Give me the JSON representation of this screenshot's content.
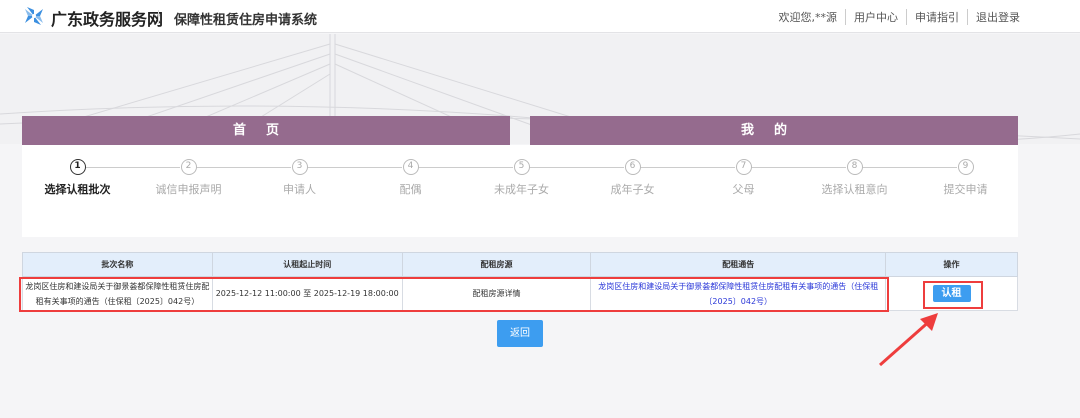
{
  "header": {
    "site_name": "广东政务服务网",
    "system_name": "保障性租赁住房申请系统",
    "nav": [
      "欢迎您,**源",
      "用户中心",
      "申请指引",
      "退出登录"
    ]
  },
  "tabs": [
    "首页",
    "我的"
  ],
  "steps": [
    {
      "num": "1",
      "label": "选择认租批次",
      "active": true
    },
    {
      "num": "2",
      "label": "诚信申报声明"
    },
    {
      "num": "3",
      "label": "申请人"
    },
    {
      "num": "4",
      "label": "配偶"
    },
    {
      "num": "5",
      "label": "未成年子女"
    },
    {
      "num": "6",
      "label": "成年子女"
    },
    {
      "num": "7",
      "label": "父母"
    },
    {
      "num": "8",
      "label": "选择认租意向"
    },
    {
      "num": "9",
      "label": "提交申请"
    }
  ],
  "table": {
    "headers": [
      "批次名称",
      "认租起止时间",
      "配租房源",
      "配租通告",
      "操作"
    ],
    "rows": [
      {
        "name": "龙岗区住房和建设局关于御景荟都保障性租赁住房配租有关事项的通告（住保租〔2025〕042号）",
        "time": "2025-12-12 11:00:00 至 2025-12-19 18:00:00",
        "source": "配租房源详情",
        "notice": "龙岗区住房和建设局关于御景荟都保障性租赁住房配租有关事项的通告（住保租〔2025〕042号）",
        "action": "认租"
      }
    ]
  },
  "back_label": "返回",
  "colors": {
    "tab": "#956b8e",
    "button": "#3d9df0",
    "highlight": "#ee3d3d"
  }
}
